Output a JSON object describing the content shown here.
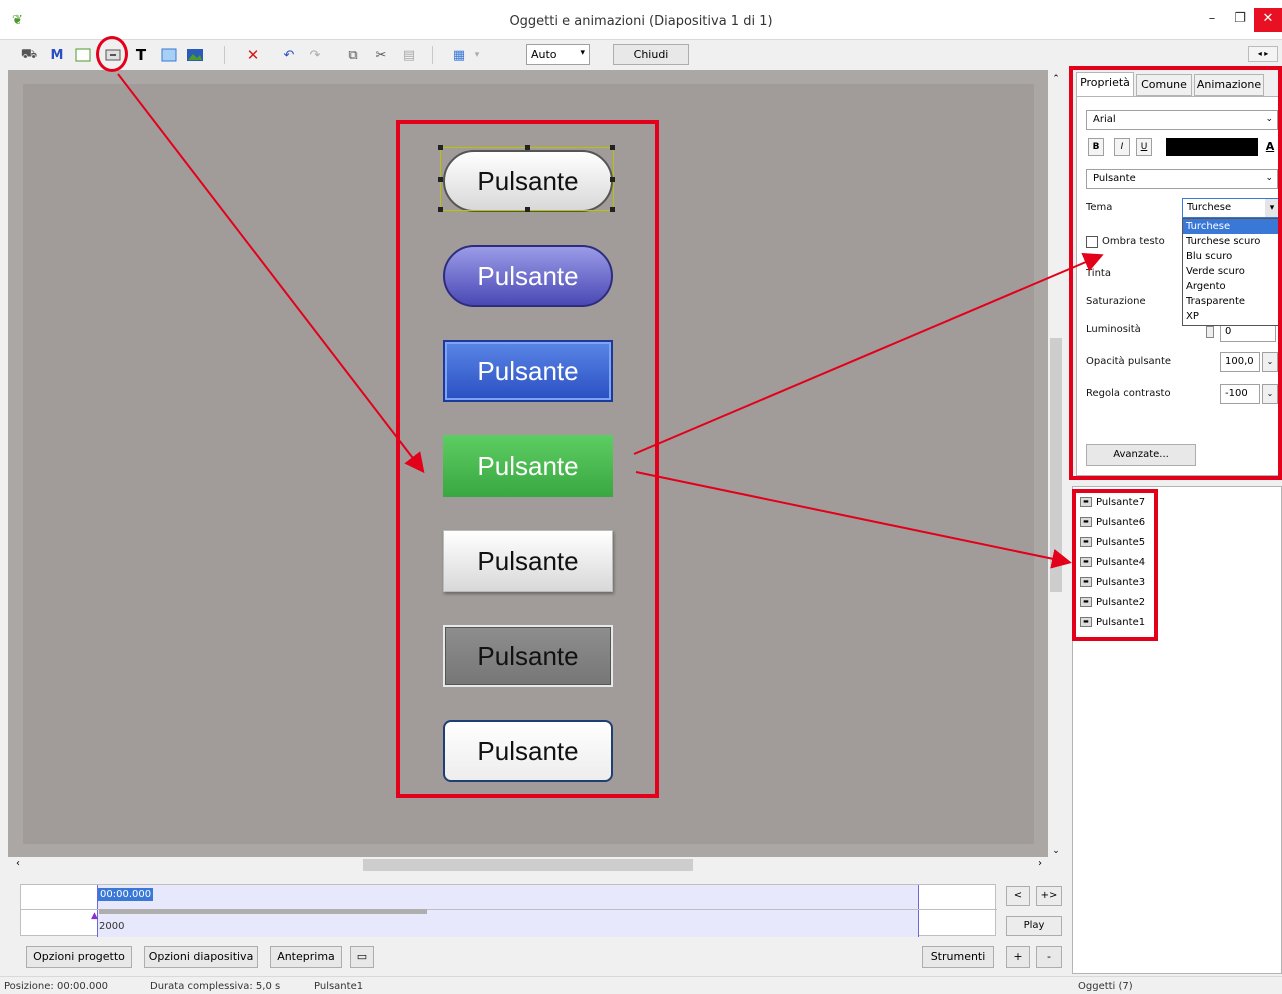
{
  "window": {
    "title": "Oggetti e animazioni  (Diapositiva 1 di 1)",
    "minimize": "–",
    "maximize": "❐",
    "close": "✕"
  },
  "toolbar": {
    "zoom_value": "Auto",
    "close_label": "Chiudi"
  },
  "canvas": {
    "buttons": [
      {
        "label": "Pulsante"
      },
      {
        "label": "Pulsante"
      },
      {
        "label": "Pulsante"
      },
      {
        "label": "Pulsante"
      },
      {
        "label": "Pulsante"
      },
      {
        "label": "Pulsante"
      },
      {
        "label": "Pulsante"
      }
    ]
  },
  "timeline": {
    "position": "00:00.000",
    "value": "2000",
    "play_label": "Play",
    "prev_label": "<",
    "next_label": "+>",
    "add_label": "+",
    "remove_label": "-"
  },
  "bottom_buttons": {
    "project_options": "Opzioni progetto",
    "slide_options": "Opzioni diapositiva",
    "preview": "Anteprima",
    "tools": "Strumenti"
  },
  "status": {
    "position": "Posizione:  00:00.000",
    "duration": "Durata complessiva:  5,0 s",
    "selected": "Pulsante1",
    "objects": "Oggetti (7)"
  },
  "properties": {
    "tabs": [
      "Proprietà",
      "Comune",
      "Animazione"
    ],
    "font": "Arial",
    "bold": "B",
    "italic": "I",
    "underline": "U",
    "color_button": "A",
    "button_type": "Pulsante",
    "theme_label": "Tema",
    "theme_value": "Turchese",
    "theme_options": [
      "Turchese",
      "Turchese scuro",
      "Blu scuro",
      "Verde scuro",
      "Argento",
      "Trasparente",
      "XP"
    ],
    "text_shadow": "Ombra testo",
    "tint": "Tinta",
    "saturation": "Saturazione",
    "brightness": "Luminosità",
    "brightness_value": "0",
    "opacity_label": "Opacità pulsante",
    "opacity_value": "100,0",
    "contrast_label": "Regola contrasto",
    "contrast_value": "-100",
    "advanced": "Avanzate..."
  },
  "objects": [
    "Pulsante7",
    "Pulsante6",
    "Pulsante5",
    "Pulsante4",
    "Pulsante3",
    "Pulsante2",
    "Pulsante1"
  ],
  "colors": {
    "annotation": "#e3001b",
    "selection": "#3a78d8"
  }
}
